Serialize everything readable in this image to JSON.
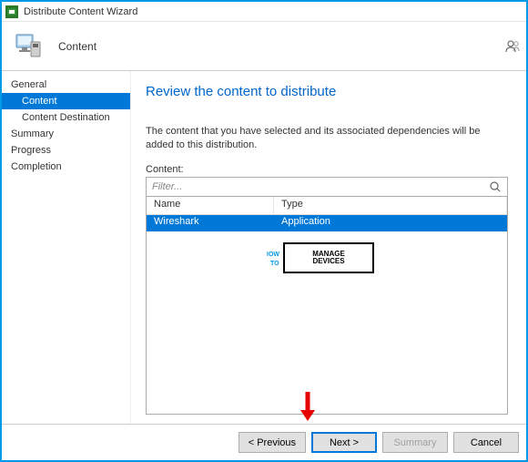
{
  "titlebar": {
    "text": "Distribute Content Wizard"
  },
  "header": {
    "title": "Content"
  },
  "sidebar": {
    "items": [
      {
        "label": "General"
      },
      {
        "label": "Content"
      },
      {
        "label": "Content Destination"
      },
      {
        "label": "Summary"
      },
      {
        "label": "Progress"
      },
      {
        "label": "Completion"
      }
    ]
  },
  "main": {
    "heading": "Review the content to distribute",
    "description": "The content that you have selected and its associated dependencies will be added to this distribution.",
    "content_label": "Content:",
    "filter_placeholder": "Filter...",
    "columns": {
      "name": "Name",
      "type": "Type"
    },
    "rows": [
      {
        "name": "Wireshark",
        "type": "Application"
      }
    ]
  },
  "footer": {
    "previous": "< Previous",
    "next": "Next >",
    "summary": "Summary",
    "cancel": "Cancel"
  }
}
